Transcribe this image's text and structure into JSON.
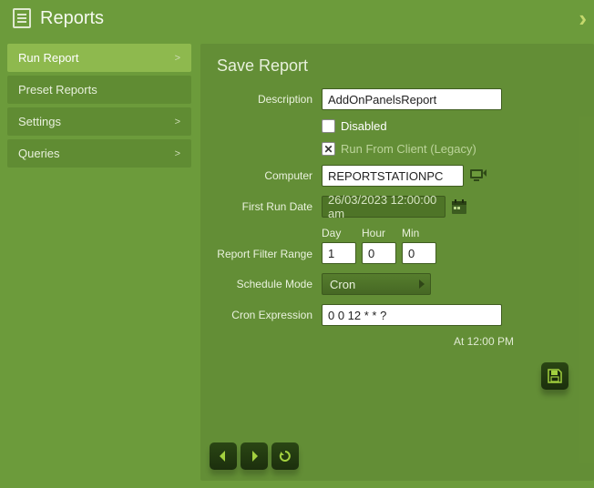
{
  "header": {
    "title": "Reports"
  },
  "sidebar": {
    "items": [
      {
        "label": "Run Report",
        "chevron": ">",
        "active": true
      },
      {
        "label": "Preset Reports",
        "chevron": "",
        "active": false
      },
      {
        "label": "Settings",
        "chevron": ">",
        "active": false
      },
      {
        "label": "Queries",
        "chevron": ">",
        "active": false
      }
    ]
  },
  "panel": {
    "title": "Save Report",
    "labels": {
      "description": "Description",
      "disabled": "Disabled",
      "run_from_client": "Run From Client (Legacy)",
      "computer": "Computer",
      "first_run_date": "First Run Date",
      "day": "Day",
      "hour": "Hour",
      "min": "Min",
      "report_filter_range": "Report Filter Range",
      "schedule_mode": "Schedule Mode",
      "cron_expression": "Cron Expression"
    },
    "values": {
      "description": "AddOnPanelsReport",
      "disabled": false,
      "run_from_client": true,
      "computer": "REPORTSTATIONPC",
      "first_run_date": "26/03/2023 12:00:00 am",
      "day": "1",
      "hour": "0",
      "min": "0",
      "schedule_mode": "Cron",
      "cron_expression": "0 0 12 * * ?",
      "cron_note": "At 12:00 PM"
    }
  },
  "colors": {
    "accent": "#a3d13f",
    "panel_bg": "#5e8832"
  }
}
